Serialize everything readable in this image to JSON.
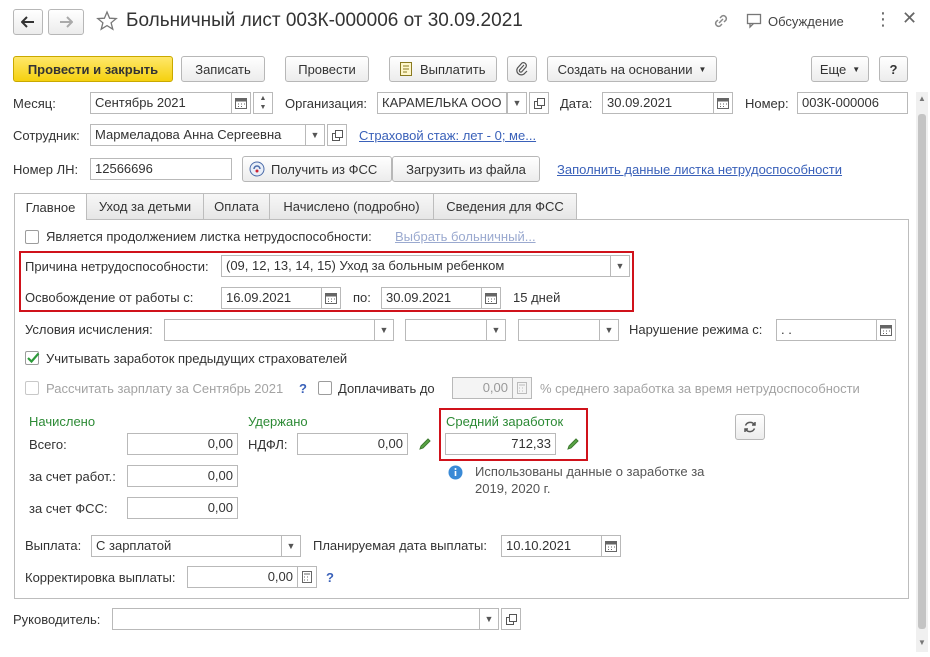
{
  "window": {
    "title": "Больничный лист 003К-000006 от 30.09.2021",
    "discussion_label": "Обсуждение"
  },
  "toolbar": {
    "post_close": "Провести и закрыть",
    "write": "Записать",
    "post": "Провести",
    "pay": "Выплатить",
    "create_based": "Создать на основании",
    "more": "Еще",
    "help": "?"
  },
  "header": {
    "month_label": "Месяц:",
    "month_value": "Сентябрь 2021",
    "org_label": "Организация:",
    "org_value": "КАРАМЕЛЬКА ООО",
    "date_label": "Дата:",
    "date_value": "30.09.2021",
    "number_label": "Номер:",
    "number_value": "003К-000006",
    "employee_label": "Сотрудник:",
    "employee_value": "Мармеладова Анна Сергеевна",
    "insurance_link": "Страховой стаж: лет - 0; ме...",
    "ln_label": "Номер ЛН:",
    "ln_value": "12566696",
    "fss_button": "Получить из ФСС",
    "load_file_button": "Загрузить из файла",
    "fill_link": "Заполнить данные листка нетрудоспособности"
  },
  "tabs": [
    {
      "label": "Главное"
    },
    {
      "label": "Уход за детьми"
    },
    {
      "label": "Оплата"
    },
    {
      "label": "Начислено (подробно)"
    },
    {
      "label": "Сведения для ФСС"
    }
  ],
  "main": {
    "continuation_label": "Является продолжением листка нетрудоспособности:",
    "choose_sick_link": "Выбрать больничный...",
    "reason_label": "Причина нетрудоспособности:",
    "reason_value": "(09, 12, 13, 14, 15) Уход за больным ребенком",
    "release_label": "Освобождение от работы с:",
    "release_from": "16.09.2021",
    "to_label": "по:",
    "release_to": "30.09.2021",
    "days_text": "15 дней",
    "calc_conditions_label": "Условия исчисления:",
    "violation_label": "Нарушение режима с:",
    "violation_value": " .  .",
    "prev_insurers_label": "Учитывать заработок предыдущих страхователей",
    "recalc_label": "Рассчитать зарплату за Сентябрь 2021",
    "question": "?",
    "extra_pay_label": "Доплачивать до",
    "extra_pay_value": "0,00",
    "percent_label": "% среднего заработка за время нетрудоспособности",
    "accrued_title": "Начислено",
    "total_label": "Всего:",
    "total_value": "0,00",
    "employer_label": "за счет работ.:",
    "employer_value": "0,00",
    "fss_label": "за счет ФСС:",
    "fss_value": "0,00",
    "withheld_title": "Удержано",
    "ndfl_label": "НДФЛ:",
    "ndfl_value": "0,00",
    "avg_title": "Средний заработок",
    "avg_value": "712,33",
    "info_text_1": "Использованы данные о заработке за",
    "info_text_2": "2019,  2020 г.",
    "payout_label": "Выплата:",
    "payout_value": "С зарплатой",
    "planned_date_label": "Планируемая дата выплаты:",
    "planned_date_value": "10.10.2021",
    "correction_label": "Корректировка выплаты:",
    "correction_value": "0,00"
  },
  "footer": {
    "manager_label": "Руководитель:",
    "manager_value": ""
  },
  "colors": {
    "primary_button": "#f5d10f",
    "highlight_border": "#d0121b",
    "link": "#3a61b9",
    "section_title": "#2c8a35"
  }
}
